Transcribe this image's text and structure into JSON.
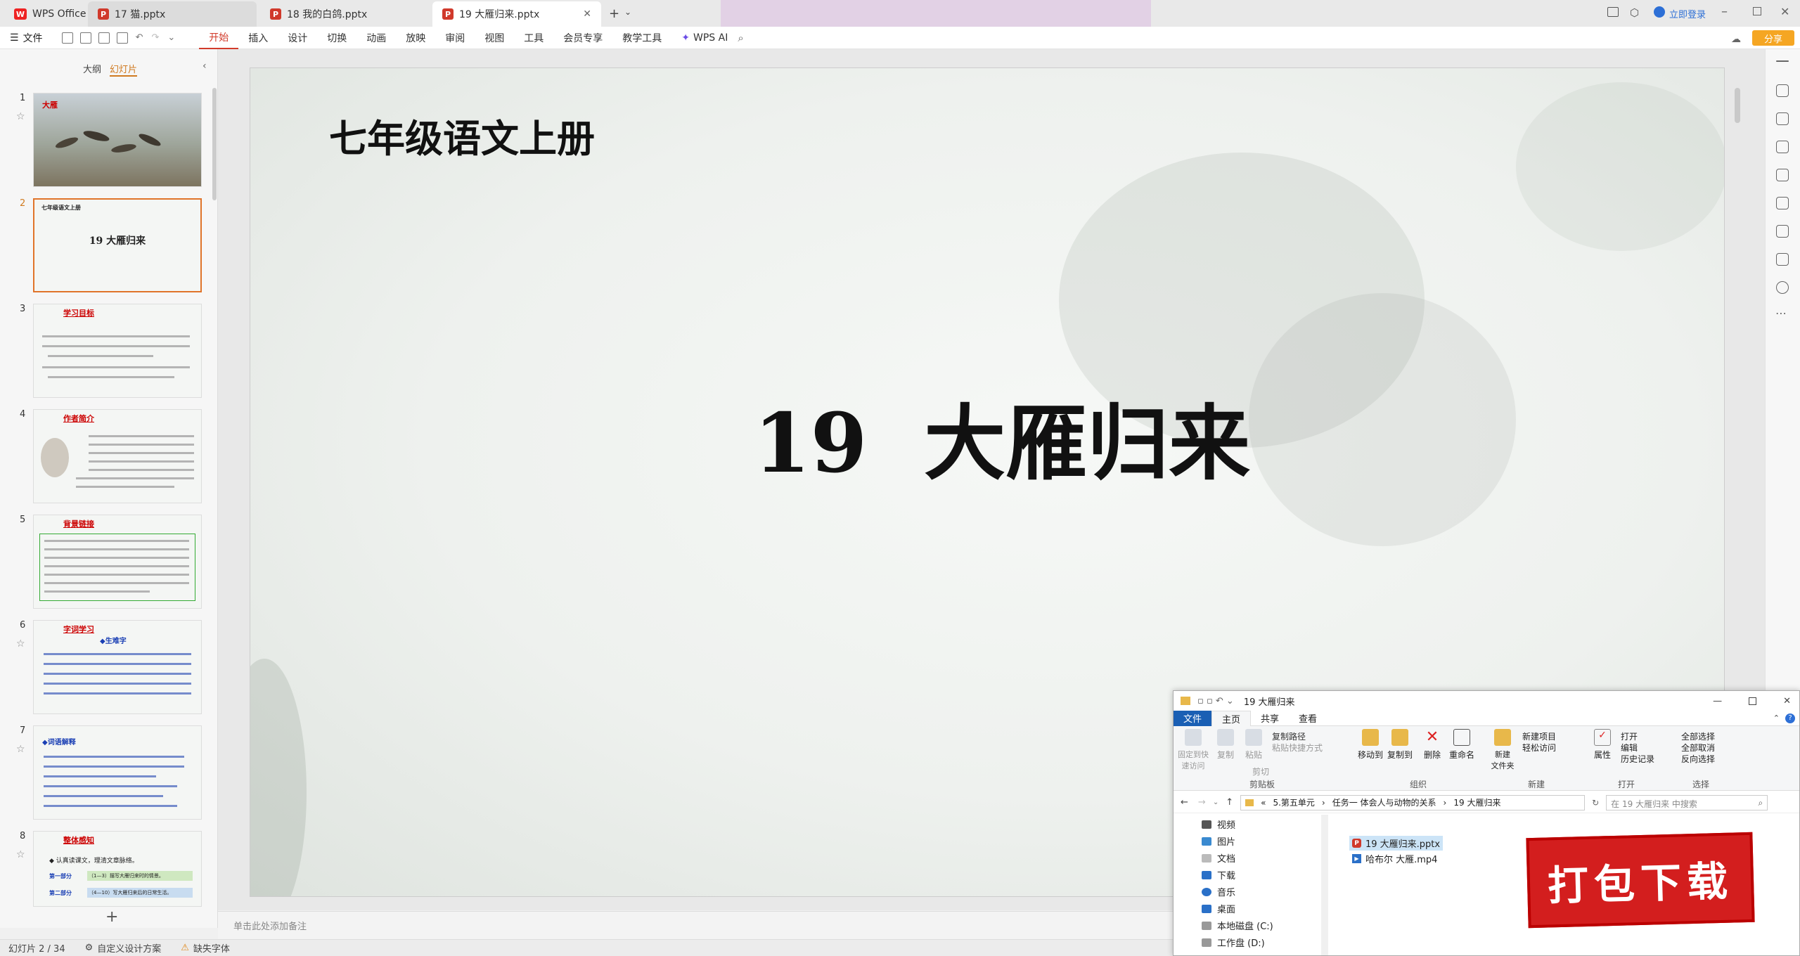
{
  "titlebar": {
    "tabs": [
      {
        "label": "WPS Office"
      },
      {
        "label": "17 猫.pptx"
      },
      {
        "label": "18 我的白鸽.pptx"
      },
      {
        "label": "19 大雁归来.pptx"
      }
    ],
    "login": "立即登录"
  },
  "ribbon": {
    "file_menu": "文件",
    "menus": [
      "开始",
      "插入",
      "设计",
      "切换",
      "动画",
      "放映",
      "审阅",
      "视图",
      "工具",
      "会员专享",
      "教学工具"
    ],
    "wps_ai": "WPS AI",
    "share": "分享"
  },
  "sidebar": {
    "tabs": [
      "大纲",
      "幻灯片"
    ],
    "slides": [
      {
        "num": "1",
        "title": "大雁"
      },
      {
        "num": "2",
        "header": "七年级语文上册",
        "title": "19 大雁归来"
      },
      {
        "num": "3",
        "title": "学习目标"
      },
      {
        "num": "4",
        "title": "作者简介"
      },
      {
        "num": "5",
        "title": "背景链接"
      },
      {
        "num": "6",
        "title": "字词学习",
        "subtitle": "◆生难字"
      },
      {
        "num": "7",
        "title": "◆词语解释"
      },
      {
        "num": "8",
        "title": "整体感知",
        "line1": "◆ 认真读课文，理清文章脉络。",
        "part1": "第一部分",
        "part1_desc": "（1—3）描写大雁归来时的情景。",
        "part2": "第二部分",
        "part2_desc": "（4—10）写大雁归来后的日常生活。"
      }
    ],
    "add": "+"
  },
  "slide": {
    "header": "七年级语文上册",
    "title": "19  大雁归来"
  },
  "notes": {
    "placeholder": "单击此处添加备注"
  },
  "status": {
    "slide_info": "幻灯片 2 / 34",
    "design": "自定义设计方案",
    "font": "缺失字体"
  },
  "explorer": {
    "title": "19 大雁归来",
    "tabs": [
      "文件",
      "主页",
      "共享",
      "查看"
    ],
    "ribbon": {
      "pin": "固定到快\n速访问",
      "copy": "复制",
      "paste": "粘贴",
      "copy_path": "复制路径",
      "paste_shortcut": "粘贴快捷方式",
      "cut": "剪切",
      "clipboard": "剪贴板",
      "move_to": "移动到",
      "copy_to": "复制到",
      "delete": "删除",
      "rename": "重命名",
      "organize": "组织",
      "new_folder": "新建\n文件夹",
      "new_item": "新建项目",
      "easy_access": "轻松访问",
      "new": "新建",
      "properties": "属性",
      "open": "打开",
      "edit": "编辑",
      "history": "历史记录",
      "open_group": "打开",
      "select_all": "全部选择",
      "select_none": "全部取消",
      "invert": "反向选择",
      "select": "选择"
    },
    "breadcrumb": [
      "«",
      "5.第五单元",
      "任务一 体会人与动物的关系",
      "19 大雁归来"
    ],
    "search_placeholder": "在 19 大雁归来 中搜索",
    "nav": [
      "视频",
      "图片",
      "文档",
      "下载",
      "音乐",
      "桌面",
      "本地磁盘 (C:)",
      "工作盘 (D:)"
    ],
    "files": [
      "19 大雁归来.pptx",
      "哈布尔 大雁.mp4"
    ]
  },
  "promo": {
    "text": "打包下载"
  }
}
